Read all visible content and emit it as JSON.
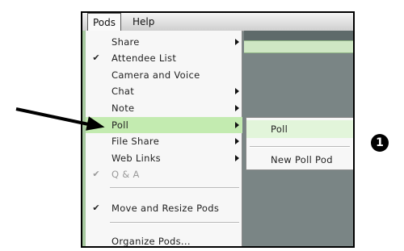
{
  "menubar": {
    "pods_label": "Pods",
    "help_label": "Help"
  },
  "pods_menu": {
    "items": [
      {
        "label": "Share",
        "checked": false,
        "submenu": true,
        "disabled": false
      },
      {
        "label": "Attendee List",
        "checked": true,
        "submenu": false,
        "disabled": false
      },
      {
        "label": "Camera and Voice",
        "checked": false,
        "submenu": false,
        "disabled": false
      },
      {
        "label": "Chat",
        "checked": false,
        "submenu": true,
        "disabled": false
      },
      {
        "label": "Note",
        "checked": false,
        "submenu": true,
        "disabled": false
      },
      {
        "label": "Poll",
        "checked": false,
        "submenu": true,
        "disabled": false,
        "highlighted": true
      },
      {
        "label": "File Share",
        "checked": false,
        "submenu": true,
        "disabled": false
      },
      {
        "label": "Web Links",
        "checked": false,
        "submenu": true,
        "disabled": false
      },
      {
        "label": "Q & A",
        "checked": true,
        "submenu": false,
        "disabled": true
      },
      {
        "label": "Move and Resize Pods",
        "checked": true,
        "submenu": false,
        "disabled": false
      },
      {
        "label": "Organize Pods...",
        "checked": false,
        "submenu": false,
        "disabled": false
      }
    ],
    "check_glyph": "✔"
  },
  "poll_submenu": {
    "items": [
      {
        "label": "Poll",
        "highlighted": true
      },
      {
        "label": "New Poll Pod",
        "highlighted": false
      }
    ]
  },
  "annotation": {
    "step_number": "1",
    "arrow_icon": "arrow-right-icon"
  },
  "colors": {
    "highlight": "#c3ebb0",
    "menu_bg": "#f7f7f7",
    "workspace": "#7a8585"
  }
}
